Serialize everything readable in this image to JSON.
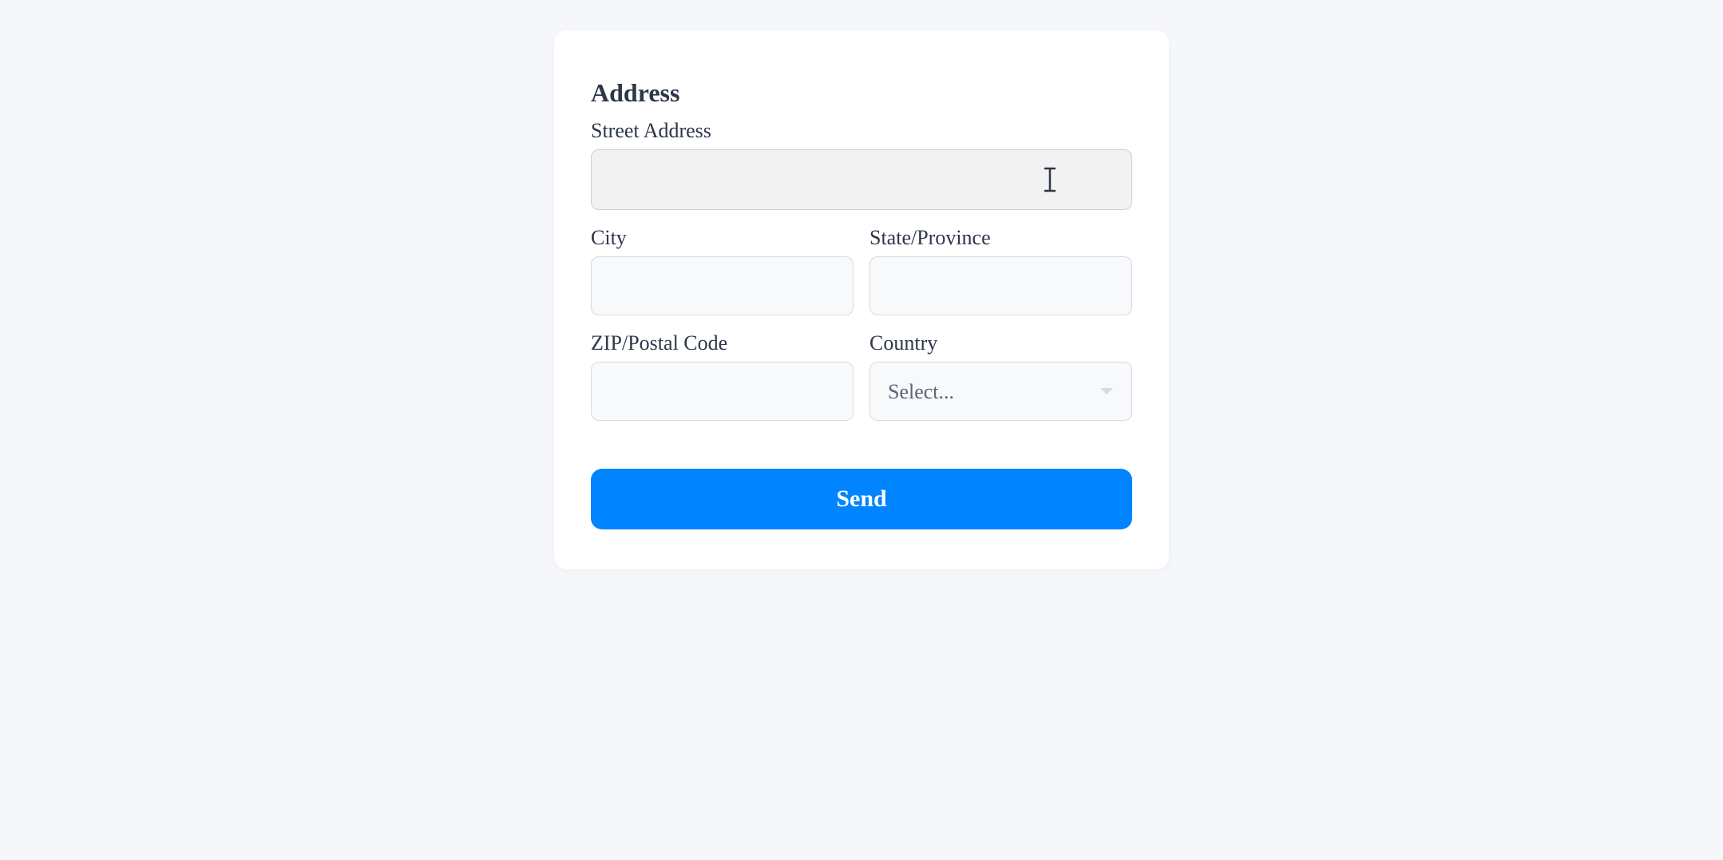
{
  "form": {
    "title": "Address",
    "street": {
      "label": "Street Address",
      "value": ""
    },
    "city": {
      "label": "City",
      "value": ""
    },
    "state": {
      "label": "State/Province",
      "value": ""
    },
    "zip": {
      "label": "ZIP/Postal Code",
      "value": ""
    },
    "country": {
      "label": "Country",
      "placeholder": "Select..."
    },
    "submit_label": "Send"
  }
}
